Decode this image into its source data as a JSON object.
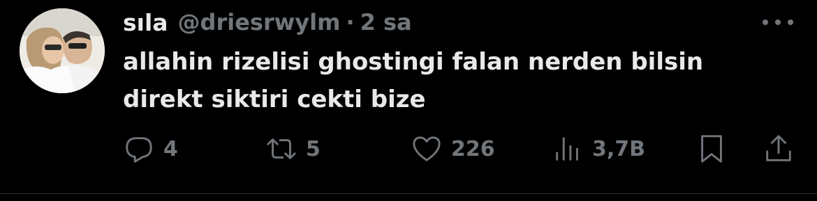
{
  "tweet": {
    "display_name": "sıla",
    "handle": "@driesrwylm",
    "separator": "·",
    "time": "2 sa",
    "text_lines": [
      "allahin rizelisi ghostingi falan nerden bilsin",
      "direkt siktiri cekti bize"
    ]
  },
  "actions": {
    "reply": {
      "icon": "reply-icon",
      "count": "4"
    },
    "retweet": {
      "icon": "retweet-icon",
      "count": "5"
    },
    "like": {
      "icon": "heart-icon",
      "count": "226"
    },
    "views": {
      "icon": "views-icon",
      "count": "3,7B"
    },
    "bookmark": {
      "icon": "bookmark-icon"
    },
    "share": {
      "icon": "share-icon"
    }
  },
  "colors": {
    "background": "#000000",
    "primary_text": "#e7e9ea",
    "secondary_text": "#71767b",
    "divider": "#2f3336"
  }
}
